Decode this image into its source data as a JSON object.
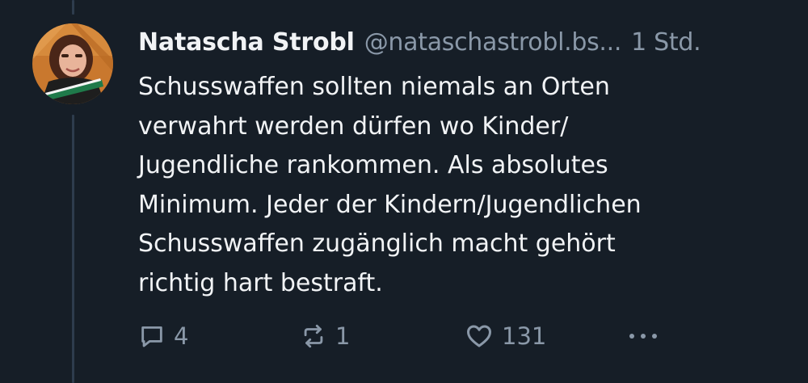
{
  "post": {
    "author_name": "Natascha Strobl",
    "handle": "@nataschastrobl.bs...",
    "timestamp": "1 Std.",
    "text_lines": [
      "Schusswaffen sollten niemals an Orten",
      "verwahrt werden dürfen wo Kinder/",
      "Jugendliche rankommen. Als absolutes",
      "Minimum. Jeder der Kindern/Jugendlichen",
      "Schusswaffen zugänglich macht gehört",
      "richtig hart bestraft."
    ]
  },
  "actions": {
    "reply_count": "4",
    "repost_count": "1",
    "like_count": "131"
  },
  "icons": {
    "reply": "speech-bubble-icon",
    "repost": "repost-arrows-icon",
    "like": "heart-icon",
    "more": "more-dots-icon"
  },
  "colors": {
    "background": "#161e27",
    "text": "#f1f3f5",
    "muted": "#8a98a8",
    "thread_line": "#2e3c4d"
  }
}
